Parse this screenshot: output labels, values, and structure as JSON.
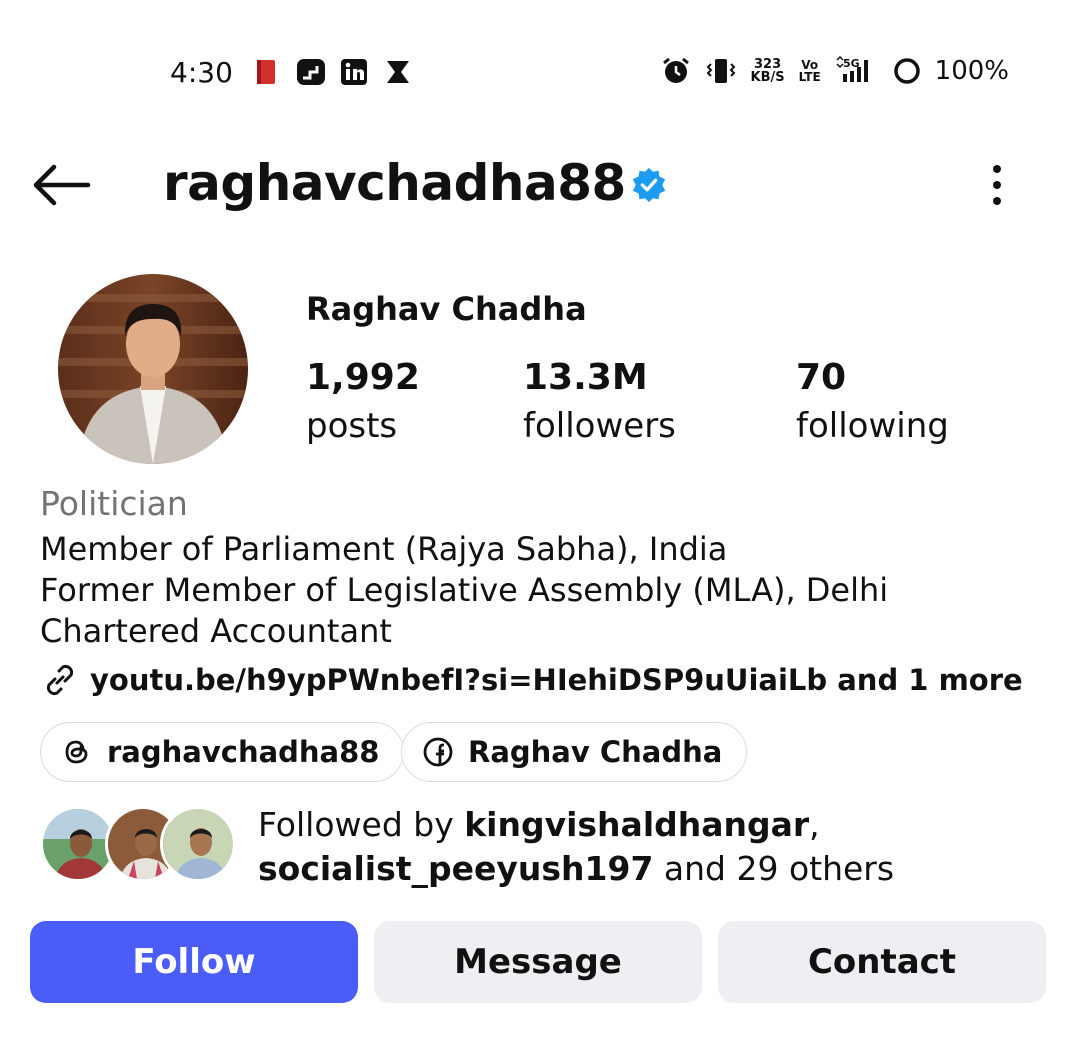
{
  "status_bar": {
    "time": "4:30",
    "left_icons": [
      "book-app-icon",
      "stack-app-icon",
      "linkedin-icon",
      "hourglass-app-icon"
    ],
    "net_speed_value": "323",
    "net_speed_unit": "KB/S",
    "volte_top": "Vo",
    "volte_bottom": "LTE",
    "network_type": "5G",
    "battery": "100%"
  },
  "header": {
    "username": "raghavchadha88",
    "verified": true,
    "accent_color": "#1d9bf0"
  },
  "profile": {
    "display_name": "Raghav Chadha",
    "stats": [
      {
        "value": "1,992",
        "label": "posts"
      },
      {
        "value": "13.3M",
        "label": "followers"
      },
      {
        "value": "70",
        "label": "following"
      }
    ]
  },
  "bio": {
    "category": "Politician",
    "lines": [
      "Member of Parliament (Rajya Sabha), India",
      "Former Member of Legislative Assembly (MLA), Delhi",
      "Chartered Accountant"
    ],
    "link": "youtu.be/h9ypPWnbefI?si=HIehiDSP9uUiaiLb and 1 more"
  },
  "chips": [
    {
      "icon": "threads-icon",
      "label": "raghavchadha88"
    },
    {
      "icon": "facebook-icon",
      "label": "Raghav Chadha"
    }
  ],
  "followed_by": {
    "prefix": "Followed by ",
    "user1": "kingvishaldhangar",
    "separator": ",",
    "user2": "socialist_peeyush197",
    "suffix": " and 29 others"
  },
  "actions": {
    "follow": "Follow",
    "message": "Message",
    "contact": "Contact",
    "follow_color": "#4a5df9"
  }
}
